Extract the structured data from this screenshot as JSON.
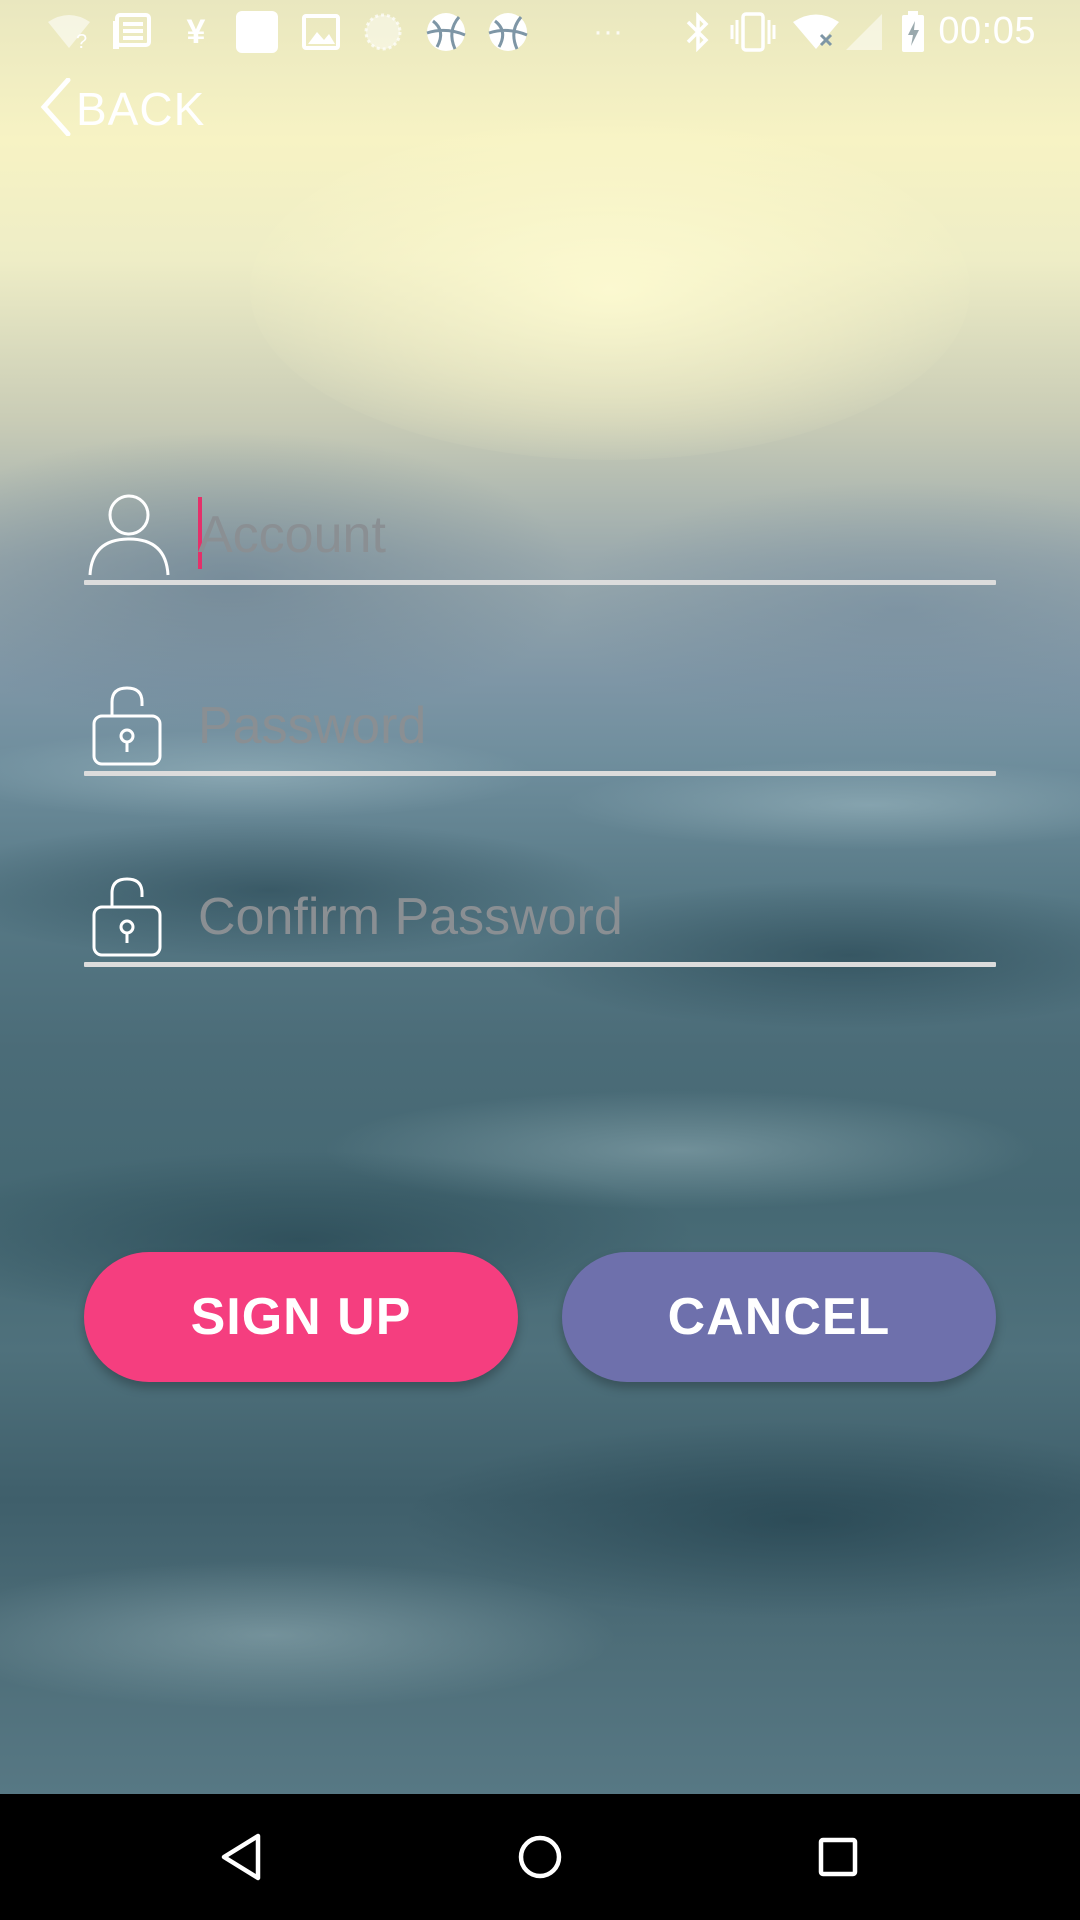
{
  "status_bar": {
    "time": "00:05",
    "icons": [
      "wifi-question-icon",
      "news-icon",
      "yen-icon",
      "square-app-icon",
      "image-icon",
      "circle-app-icon",
      "ball-icon",
      "ball-icon",
      "more-dots-icon",
      "bluetooth-icon",
      "vibrate-icon",
      "wifi-off-icon",
      "signal-icon",
      "battery-charging-icon"
    ],
    "more_dots": "···"
  },
  "header": {
    "back_label": "BACK"
  },
  "form": {
    "account": {
      "placeholder": "Account",
      "value": ""
    },
    "password": {
      "placeholder": "Password",
      "value": ""
    },
    "confirm_password": {
      "placeholder": "Confirm Password",
      "value": ""
    }
  },
  "actions": {
    "signup_label": "SIGN UP",
    "cancel_label": "CANCEL"
  },
  "colors": {
    "signup": "#f53e7f",
    "cancel": "#6e70ac",
    "caret": "#e4306a",
    "underline": "#dcdcdc"
  },
  "nav_bar": {
    "icons": [
      "back-triangle-icon",
      "home-circle-icon",
      "recents-square-icon"
    ]
  }
}
